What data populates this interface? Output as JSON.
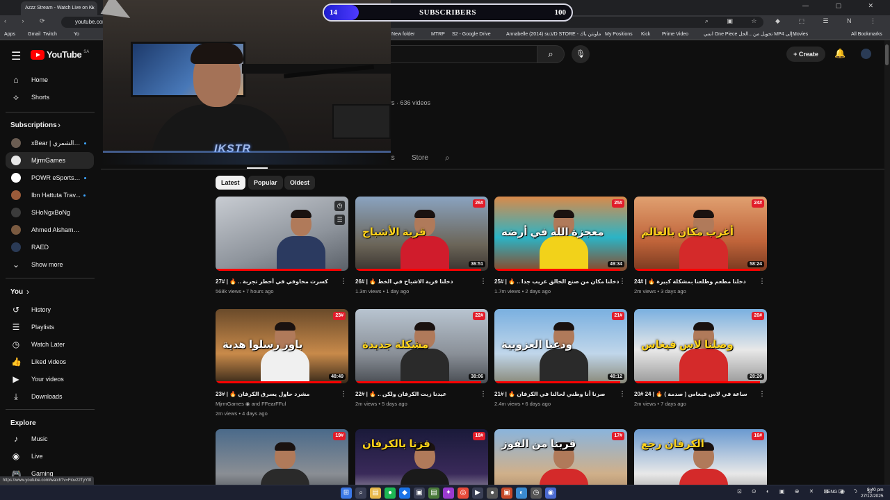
{
  "browser": {
    "tab_title": "Azzz Stream - Watch Live on Ki",
    "tab_close": "×",
    "url": "youtube.com/@r",
    "window_controls": "—  ▢  ✕",
    "nav_icons": "‹ › ⟳",
    "ext_icons": "⌕ ▣ ☆ ◆ ⬚ ☰ N ⋮",
    "bookmarks": [
      "Apps",
      "Gmail",
      "Twitch",
      "Yo",
      "New folder",
      "MTRP",
      "S2 - Google Drive",
      "Annabelle (2014) su...",
      "VD STORE - ماونتن باك",
      "My Positions",
      "Kick",
      "Prime Video",
      "انمي One Piece الحل...",
      "تحويل من MP4 إلى...",
      "Movies",
      "All Bookmarks"
    ],
    "status_url": "https://www.youtube.com/watch?v=Fiov22TyYI0"
  },
  "youtube": {
    "logo_text": "YouTube",
    "logo_region": "SA",
    "create_label": "Create",
    "icons": {
      "menu": "☰",
      "search": "⌕",
      "mic": "🎙",
      "plus": "+",
      "bell": "🔔"
    }
  },
  "sidebar": {
    "main": [
      {
        "label": "Home",
        "icon": "⌂"
      },
      {
        "label": "Shorts",
        "icon": "⟡"
      }
    ],
    "subscriptions_heading": "Subscriptions",
    "subscriptions": [
      {
        "label": "xBear | عايد الشمري ...",
        "color": "#6b5d52",
        "live": true
      },
      {
        "label": "MjrmGames",
        "color": "#e8e8e8",
        "live": false,
        "active": true
      },
      {
        "label": "POWR eSports | ...",
        "color": "#ffffff",
        "live": true
      },
      {
        "label": "Ibn Hattuta Trav...",
        "color": "#9b5b3a",
        "live": true
      },
      {
        "label": "SHoNgxBoNg",
        "color": "#3b3b3b",
        "live": false
      },
      {
        "label": "Ahmed Alshammari",
        "color": "#7a5a40",
        "live": false
      },
      {
        "label": "RAED",
        "color": "#2a3a55",
        "live": false
      }
    ],
    "show_more": "Show more",
    "you_heading": "You",
    "you": [
      {
        "label": "History",
        "icon": "↺"
      },
      {
        "label": "Playlists",
        "icon": "☰"
      },
      {
        "label": "Watch Later",
        "icon": "◷"
      },
      {
        "label": "Liked videos",
        "icon": "👍"
      },
      {
        "label": "Your videos",
        "icon": "▶"
      },
      {
        "label": "Downloads",
        "icon": "⤓"
      }
    ],
    "explore_heading": "Explore",
    "explore": [
      {
        "label": "Music",
        "icon": "♪"
      },
      {
        "label": "Live",
        "icon": "◉"
      },
      {
        "label": "Gaming",
        "icon": "🎮"
      }
    ]
  },
  "channel": {
    "meta": "rs · 636 videos",
    "tabs": [
      "ts",
      "Store"
    ],
    "chips": [
      "Latest",
      "Popular",
      "Oldest"
    ]
  },
  "videos": [
    {
      "title": "كسرت مخاوفي في أخطر تجربة .. 🔥 | #27",
      "views": "568k views",
      "age": "7 hours ago",
      "duration": "",
      "badge": "",
      "thumb_text": "",
      "bg": "linear-gradient(160deg,#c8ccd2,#8e949c 60%,#5a6068)",
      "shirt": "#2b3a60",
      "progress": 0.95,
      "hover": true
    },
    {
      "title": "دخلنا قرية الاشباح في الخط 🔥 | #26",
      "views": "1.3m views",
      "age": "1 day ago",
      "duration": "36:51",
      "badge": "26#",
      "thumb_text": "قرية الأشباح",
      "bg": "linear-gradient(180deg,#8aa3c0,#6b6558 65%,#3a3430)",
      "shirt": "#d01c2c",
      "progress": 0.95
    },
    {
      "title": "دخلنا مكان من صنع الخالق غريب جدا .. 🔥 | #25",
      "views": "1.7m views",
      "age": "2 days ago",
      "duration": "49:34",
      "badge": "25#",
      "thumb_text": "معجزة الله في أرضه",
      "bg": "linear-gradient(180deg,#d98a4a,#2bb4c6 55%,#8a4a2a)",
      "shirt": "#f2d21a",
      "progress": 0.95
    },
    {
      "title": "دخلنا مطعم وطلعنا بمشكلة كبيرة 🔥 | #24",
      "views": "2m views",
      "age": "3 days ago",
      "duration": "58:24",
      "badge": "24#",
      "thumb_text": "أغرب مكان بالعالم",
      "bg": "linear-gradient(180deg,#e0a070,#c0643a 60%,#7a3a20)",
      "shirt": "#d42a2a",
      "progress": 0.95
    },
    {
      "title": "مشرد حاول يسرق الكرفان 🔥 | #23",
      "views": "2m views",
      "age": "4 days ago",
      "duration": "48:49",
      "badge": "23#",
      "thumb_text": "باور رسلوا هدية",
      "bg": "linear-gradient(180deg,#6a4a2a,#c88a4a 60%,#3a2a1a)",
      "shirt": "#f0f0f0",
      "progress": 0.95,
      "channel": "MjrmGames",
      "channel2": "and FFearFFul"
    },
    {
      "title": "عيدنا زيت الكرفان ولكن .. 🔥 | #22",
      "views": "2m views",
      "age": "5 days ago",
      "duration": "38:06",
      "badge": "22#",
      "thumb_text": "مشكلة جديدة",
      "bg": "linear-gradient(180deg,#b8c4d0,#8a9098 60%,#4a4e54)",
      "shirt": "#2a2a2a",
      "progress": 0.95
    },
    {
      "title": "صرنا أنا وطني لحالنا في الكرفان 🔥 | #21",
      "views": "2.4m views",
      "age": "6 days ago",
      "duration": "48:12",
      "badge": "21#",
      "thumb_text": "ودعنا العزوبية",
      "bg": "linear-gradient(180deg,#7ab0e0,#c0d6ea 60%,#8a8a7a)",
      "shirt": "#2a2a2a",
      "progress": 0.95
    },
    {
      "title": "ساعة في لاس فيغاس ( صدمة ) 🔥 | 24 #20",
      "views": "2m views",
      "age": "7 days ago",
      "duration": "28:26",
      "badge": "20#",
      "thumb_text": "وصلنا لاس فيغاس",
      "bg": "linear-gradient(180deg,#7ab0e0,#e8e8e8 55%,#9a9a9a)",
      "shirt": "#d42a2a",
      "progress": 0.95
    },
    {
      "title": "",
      "views": "",
      "age": "",
      "duration": "",
      "badge": "19#",
      "thumb_text": "",
      "bg": "linear-gradient(180deg,#4a6a8a,#8a8e94 60%,#3a3e44)",
      "shirt": "#2a2a2a",
      "progress": 0
    },
    {
      "title": "",
      "views": "",
      "age": "",
      "duration": "",
      "badge": "18#",
      "thumb_text": "فزنا بالكرفان",
      "bg": "linear-gradient(180deg,#1a1a3a,#3a2a5a 60%,#c8c8c8)",
      "shirt": "#1a1a1a",
      "progress": 0
    },
    {
      "title": "",
      "views": "",
      "age": "",
      "duration": "",
      "badge": "17#",
      "thumb_text": "قربنا من الفوز",
      "bg": "linear-gradient(180deg,#8ab4dc,#d0b08a 60%,#9a7a5a)",
      "shirt": "#d42a2a",
      "progress": 0
    },
    {
      "title": "",
      "views": "",
      "age": "",
      "duration": "",
      "badge": "16#",
      "thumb_text": "الكرفان رجع",
      "bg": "linear-gradient(180deg,#6a9ad0,#e8e8e8 60%,#8a8a8a)",
      "shirt": "#d42a2a",
      "progress": 0
    }
  ],
  "overlay": {
    "sub_current": "14",
    "sub_label": "SUBSCRIBERS",
    "sub_goal": "100",
    "sub_progress": 0.14,
    "cam_logo": "IKSTR"
  },
  "taskbar": {
    "icons": [
      "⊞",
      "⌕",
      "▤",
      "●",
      "◆",
      "▣",
      "▤",
      "✦",
      "◎",
      "▶",
      "●",
      "▣",
      "◐",
      "◷",
      "◉"
    ],
    "tray": "⊡ ⊙ ◐ ▣ ⊕ ✕ ⊠ ⊡ ⌃",
    "lang": "ENG",
    "tray2": "◉ ♪ ⊡",
    "time": "8:40 pm",
    "date": "27/12/2025"
  }
}
